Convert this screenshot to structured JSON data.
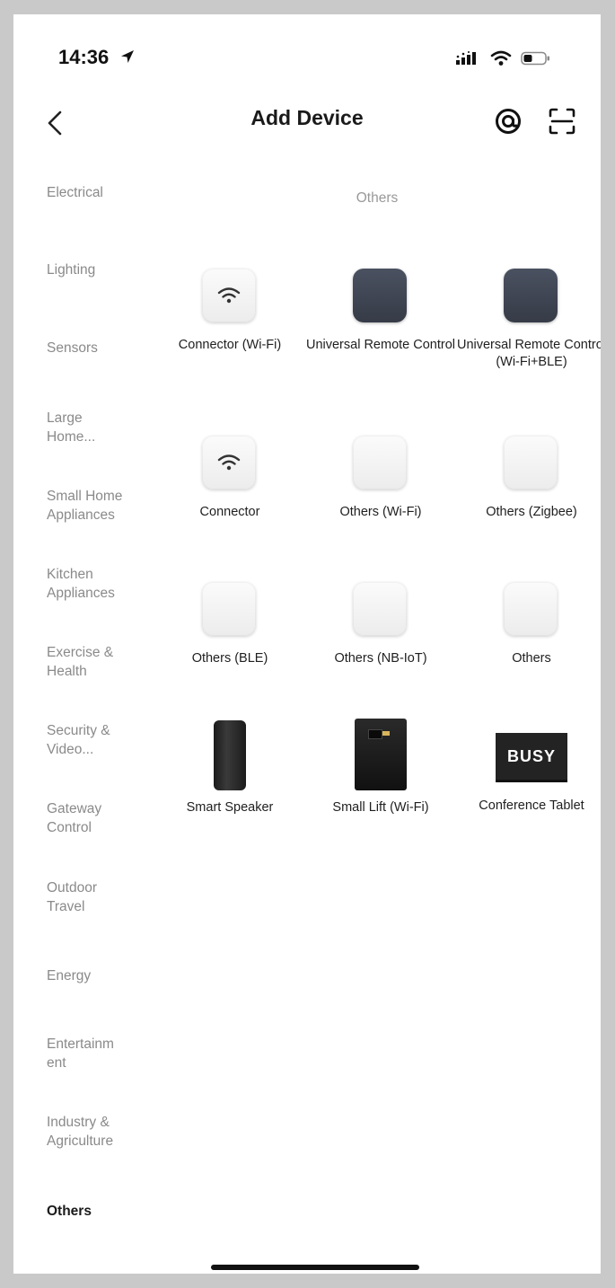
{
  "status": {
    "time": "14:36"
  },
  "header": {
    "title": "Add Device"
  },
  "sidebar": {
    "items": [
      {
        "label": "Electrical"
      },
      {
        "label": "Lighting"
      },
      {
        "label": "Sensors"
      },
      {
        "label": "Large Home..."
      },
      {
        "label": "Small Home Appliances"
      },
      {
        "label": "Kitchen Appliances"
      },
      {
        "label": "Exercise & Health"
      },
      {
        "label": "Security & Video..."
      },
      {
        "label": "Gateway Control"
      },
      {
        "label": "Outdoor Travel"
      },
      {
        "label": "Energy"
      },
      {
        "label": "Entertainm ent"
      },
      {
        "label": "Industry & Agriculture"
      },
      {
        "label": "Others",
        "active": true
      }
    ]
  },
  "main": {
    "section_title": "Others",
    "devices": [
      {
        "label": "Connector (Wi-Fi)",
        "icon": "wifi-tile-icon"
      },
      {
        "label": "Universal Remote Control",
        "icon": "remote-tile-icon"
      },
      {
        "label": "Universal Remote Control (Wi-Fi+BLE)",
        "icon": "remote-tile-icon"
      },
      {
        "label": "Connector",
        "icon": "wifi-tile-icon"
      },
      {
        "label": "Others (Wi-Fi)",
        "icon": "blank-tile-icon"
      },
      {
        "label": "Others (Zigbee)",
        "icon": "blank-tile-icon"
      },
      {
        "label": "Others (BLE)",
        "icon": "blank-tile-icon"
      },
      {
        "label": "Others (NB-IoT)",
        "icon": "blank-tile-icon"
      },
      {
        "label": "Others",
        "icon": "blank-tile-icon"
      },
      {
        "label": "Smart Speaker",
        "icon": "speaker-icon"
      },
      {
        "label": "Small Lift (Wi-Fi)",
        "icon": "lift-icon"
      },
      {
        "label": "Conference Tablet",
        "icon": "busy-sign-icon",
        "badge_text": "BUSY"
      }
    ]
  },
  "colors": {
    "active_text": "#1a1a1a",
    "inactive_text": "#8a8a8a",
    "dark_tile": "#3d4350"
  }
}
